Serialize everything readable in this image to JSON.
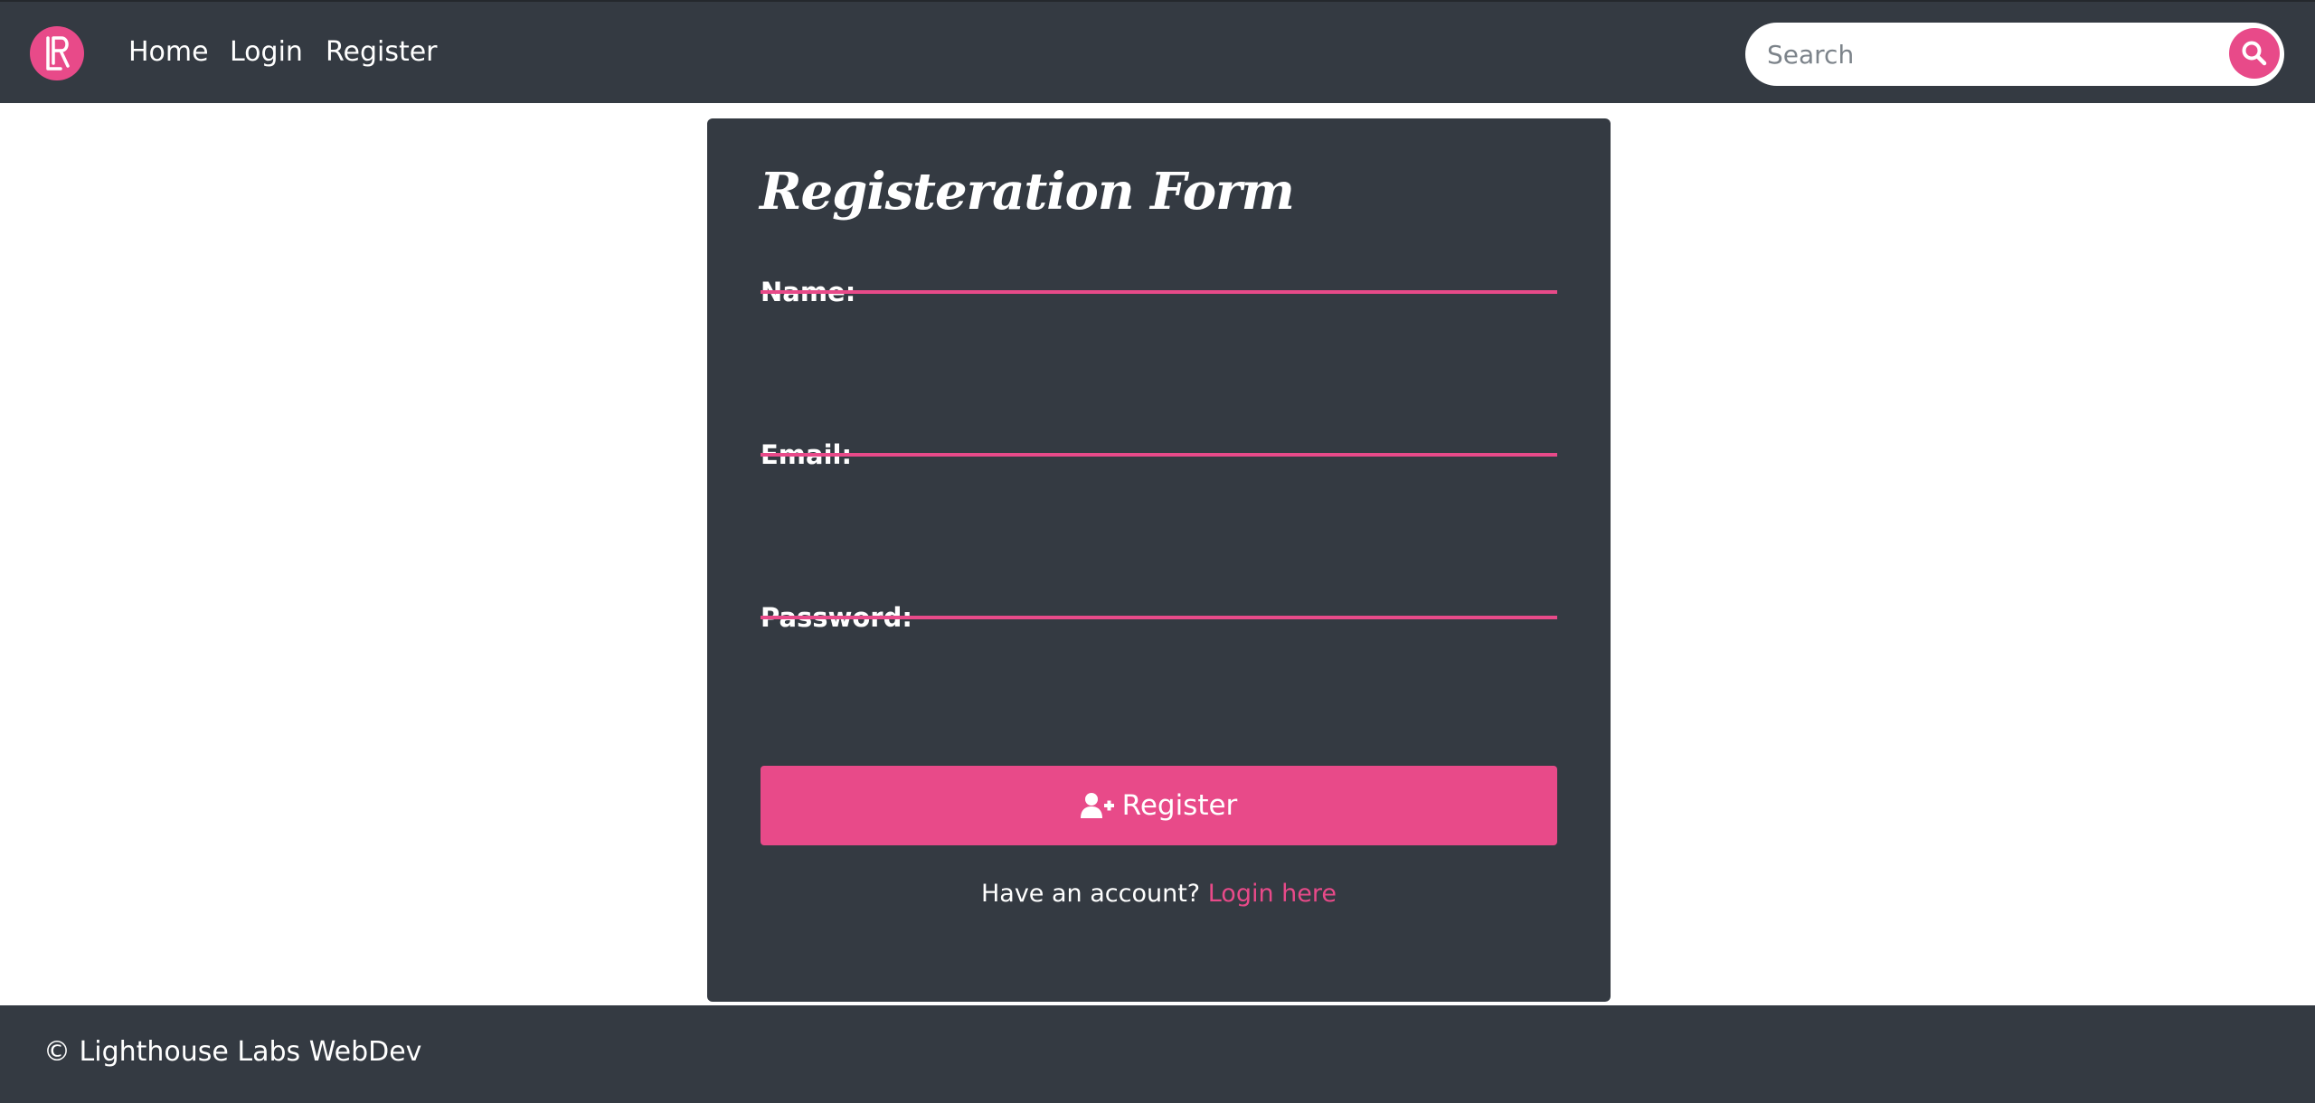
{
  "navbar": {
    "logo_icon": "lr-logo-icon",
    "links": [
      "Home",
      "Login",
      "Register"
    ],
    "search": {
      "placeholder": "Search",
      "value": "",
      "icon": "search-icon"
    }
  },
  "form": {
    "title": "Registeration Form",
    "fields": [
      {
        "label": "Name:",
        "value": ""
      },
      {
        "label": "Email:",
        "value": ""
      },
      {
        "label": "Password:",
        "value": ""
      }
    ],
    "submit_label": "Register",
    "submit_icon": "user-plus-icon",
    "account_prompt": "Have an account?",
    "login_link": "Login here"
  },
  "footer": {
    "text": "© Lighthouse Labs WebDev"
  },
  "colors": {
    "accent": "#e84a89",
    "dark": "#343a42",
    "background": "#ffffff"
  }
}
